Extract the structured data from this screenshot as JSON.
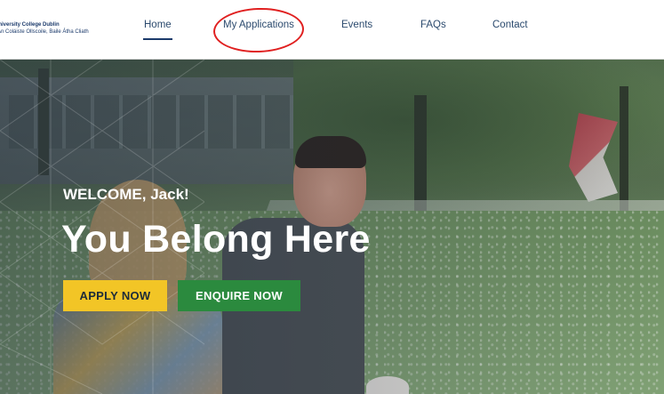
{
  "header": {
    "logo": {
      "line1": "University College Dublin",
      "line2": "An Coláiste Ollscoile, Baile Átha Cliath"
    },
    "nav": {
      "home": "Home",
      "my_applications": "My Applications",
      "events": "Events",
      "faqs": "FAQs",
      "contact": "Contact"
    },
    "active_item": "Home",
    "annotation_color": "#e02020"
  },
  "hero": {
    "welcome": "WELCOME, Jack!",
    "headline": "You Belong Here",
    "apply_button": "APPLY NOW",
    "enquire_button": "ENQUIRE NOW"
  },
  "colors": {
    "nav_text": "#2b4a6e",
    "apply_bg": "#f2c526",
    "enquire_bg": "#2b8a3e"
  }
}
